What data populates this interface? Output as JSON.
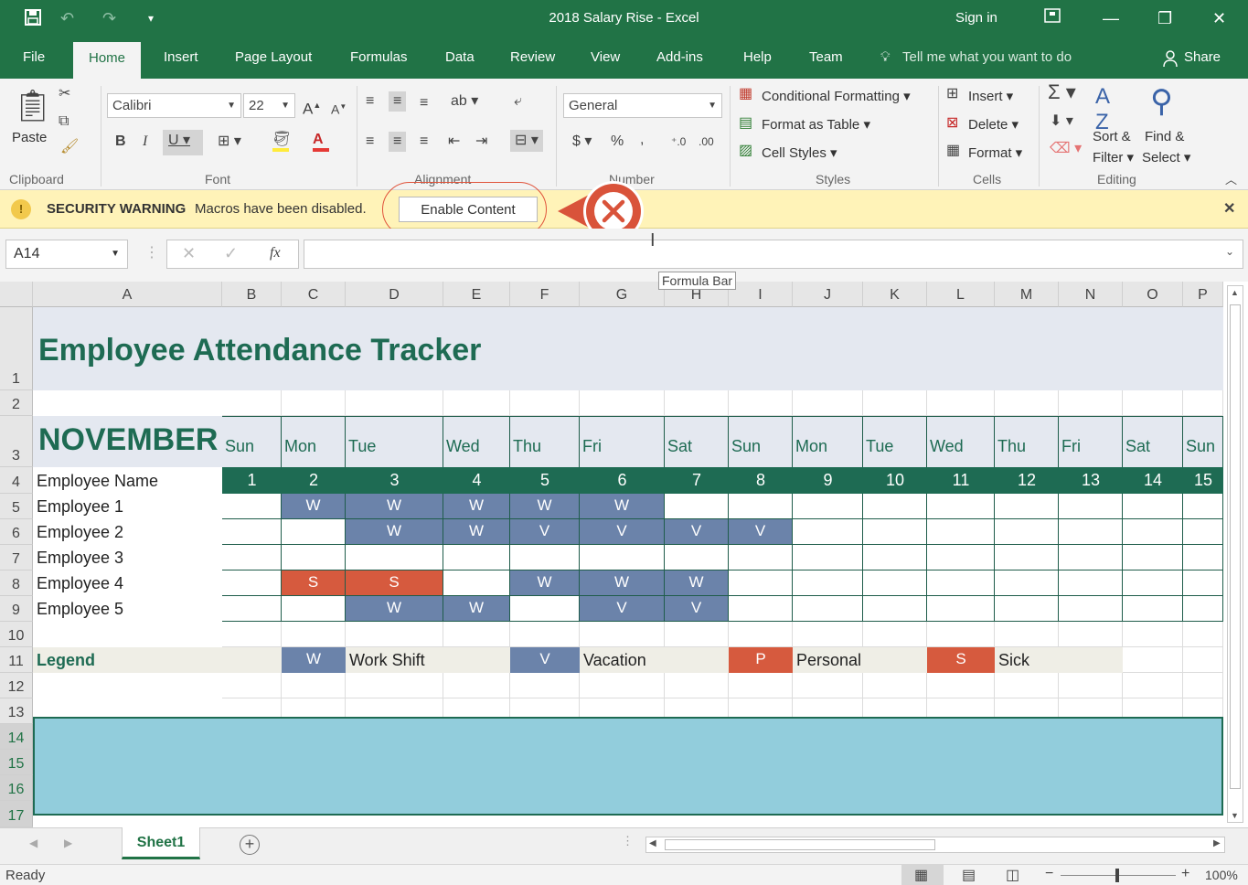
{
  "titlebar": {
    "title": "2018 Salary Rise  -  Excel",
    "signin": "Sign in"
  },
  "tabs": [
    "File",
    "Home",
    "Insert",
    "Page Layout",
    "Formulas",
    "Data",
    "Review",
    "View",
    "Add-ins",
    "Help",
    "Team"
  ],
  "tell_me": "Tell me what you want to do",
  "share": "Share",
  "ribbon": {
    "paste": "Paste",
    "clipboard": "Clipboard",
    "font_name": "Calibri",
    "font_size": "22",
    "font": "Font",
    "alignment": "Alignment",
    "number_format": "General",
    "number": "Number",
    "conditional_formatting": "Conditional Formatting",
    "format_as_table": "Format as Table",
    "cell_styles": "Cell Styles",
    "styles": "Styles",
    "insert": "Insert",
    "delete": "Delete",
    "format": "Format",
    "cells": "Cells",
    "sort_filter_1": "Sort &",
    "sort_filter_2": "Filter",
    "find_select_1": "Find &",
    "find_select_2": "Select",
    "editing": "Editing"
  },
  "security": {
    "label": "SECURITY WARNING",
    "message": "Macros have been disabled.",
    "button": "Enable Content"
  },
  "formula_bar": {
    "name_box": "A14",
    "fx": "fx",
    "tooltip": "Formula Bar",
    "content": ""
  },
  "columns": [
    "A",
    "B",
    "C",
    "D",
    "E",
    "F",
    "G",
    "H",
    "I",
    "J",
    "K",
    "L",
    "M",
    "N",
    "O",
    "P"
  ],
  "rows": [
    "1",
    "2",
    "3",
    "4",
    "5",
    "6",
    "7",
    "8",
    "9",
    "10",
    "11",
    "12",
    "13",
    "14",
    "15",
    "16",
    "17"
  ],
  "sheet": {
    "title": "Employee Attendance Tracker",
    "month": "NOVEMBER",
    "weekdays": [
      "Sun",
      "Mon",
      "Tue",
      "Wed",
      "Thu",
      "Fri",
      "Sat",
      "Sun",
      "Mon",
      "Tue",
      "Wed",
      "Thu",
      "Fri",
      "Sat",
      "Sun"
    ],
    "dates": [
      "1",
      "2",
      "3",
      "4",
      "5",
      "6",
      "7",
      "8",
      "9",
      "10",
      "11",
      "12",
      "13",
      "14",
      "15"
    ],
    "name_header": "Employee Name",
    "employees": [
      {
        "name": "Employee 1",
        "marks": [
          "",
          "W",
          "W",
          "W",
          "W",
          "W",
          "",
          "",
          "",
          "",
          "",
          "",
          "",
          "",
          ""
        ]
      },
      {
        "name": "Employee 2",
        "marks": [
          "",
          "",
          "W",
          "W",
          "V",
          "V",
          "V",
          "V",
          "",
          "",
          "",
          "",
          "",
          "",
          ""
        ]
      },
      {
        "name": "Employee 3",
        "marks": [
          "",
          "",
          "",
          "",
          "",
          "",
          "",
          "",
          "",
          "",
          "",
          "",
          "",
          "",
          ""
        ]
      },
      {
        "name": "Employee 4",
        "marks": [
          "",
          "S",
          "S",
          "",
          "W",
          "W",
          "W",
          "",
          "",
          "",
          "",
          "",
          "",
          "",
          ""
        ]
      },
      {
        "name": "Employee 5",
        "marks": [
          "",
          "",
          "W",
          "W",
          "",
          "V",
          "V",
          "",
          "",
          "",
          "",
          "",
          "",
          "",
          ""
        ]
      }
    ],
    "legend_label": "Legend",
    "legend": [
      {
        "code": "W",
        "text": "Work Shift"
      },
      {
        "code": "V",
        "text": "Vacation"
      },
      {
        "code": "P",
        "text": "Personal"
      },
      {
        "code": "S",
        "text": "Sick"
      }
    ]
  },
  "sheet_tab": "Sheet1",
  "status": {
    "ready": "Ready",
    "zoom": "100%"
  },
  "colors": {
    "excel_green": "#217346",
    "work": "#6b83aa",
    "sick": "#d65a3e",
    "header_green": "#1e6b53",
    "selection": "#92cddc"
  }
}
